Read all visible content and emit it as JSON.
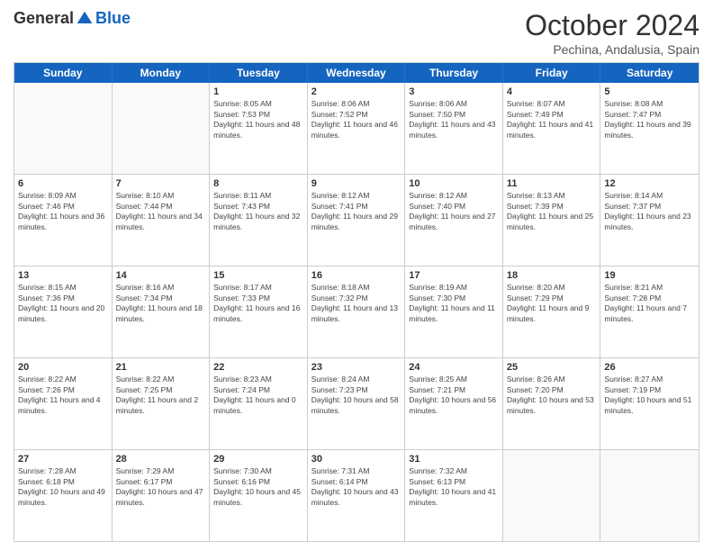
{
  "header": {
    "logo": {
      "general": "General",
      "blue": "Blue"
    },
    "title": "October 2024",
    "location": "Pechina, Andalusia, Spain"
  },
  "calendar": {
    "days": [
      "Sunday",
      "Monday",
      "Tuesday",
      "Wednesday",
      "Thursday",
      "Friday",
      "Saturday"
    ],
    "rows": [
      [
        {
          "day": "",
          "info": ""
        },
        {
          "day": "",
          "info": ""
        },
        {
          "day": "1",
          "info": "Sunrise: 8:05 AM\nSunset: 7:53 PM\nDaylight: 11 hours and 48 minutes."
        },
        {
          "day": "2",
          "info": "Sunrise: 8:06 AM\nSunset: 7:52 PM\nDaylight: 11 hours and 46 minutes."
        },
        {
          "day": "3",
          "info": "Sunrise: 8:06 AM\nSunset: 7:50 PM\nDaylight: 11 hours and 43 minutes."
        },
        {
          "day": "4",
          "info": "Sunrise: 8:07 AM\nSunset: 7:49 PM\nDaylight: 11 hours and 41 minutes."
        },
        {
          "day": "5",
          "info": "Sunrise: 8:08 AM\nSunset: 7:47 PM\nDaylight: 11 hours and 39 minutes."
        }
      ],
      [
        {
          "day": "6",
          "info": "Sunrise: 8:09 AM\nSunset: 7:46 PM\nDaylight: 11 hours and 36 minutes."
        },
        {
          "day": "7",
          "info": "Sunrise: 8:10 AM\nSunset: 7:44 PM\nDaylight: 11 hours and 34 minutes."
        },
        {
          "day": "8",
          "info": "Sunrise: 8:11 AM\nSunset: 7:43 PM\nDaylight: 11 hours and 32 minutes."
        },
        {
          "day": "9",
          "info": "Sunrise: 8:12 AM\nSunset: 7:41 PM\nDaylight: 11 hours and 29 minutes."
        },
        {
          "day": "10",
          "info": "Sunrise: 8:12 AM\nSunset: 7:40 PM\nDaylight: 11 hours and 27 minutes."
        },
        {
          "day": "11",
          "info": "Sunrise: 8:13 AM\nSunset: 7:39 PM\nDaylight: 11 hours and 25 minutes."
        },
        {
          "day": "12",
          "info": "Sunrise: 8:14 AM\nSunset: 7:37 PM\nDaylight: 11 hours and 23 minutes."
        }
      ],
      [
        {
          "day": "13",
          "info": "Sunrise: 8:15 AM\nSunset: 7:36 PM\nDaylight: 11 hours and 20 minutes."
        },
        {
          "day": "14",
          "info": "Sunrise: 8:16 AM\nSunset: 7:34 PM\nDaylight: 11 hours and 18 minutes."
        },
        {
          "day": "15",
          "info": "Sunrise: 8:17 AM\nSunset: 7:33 PM\nDaylight: 11 hours and 16 minutes."
        },
        {
          "day": "16",
          "info": "Sunrise: 8:18 AM\nSunset: 7:32 PM\nDaylight: 11 hours and 13 minutes."
        },
        {
          "day": "17",
          "info": "Sunrise: 8:19 AM\nSunset: 7:30 PM\nDaylight: 11 hours and 11 minutes."
        },
        {
          "day": "18",
          "info": "Sunrise: 8:20 AM\nSunset: 7:29 PM\nDaylight: 11 hours and 9 minutes."
        },
        {
          "day": "19",
          "info": "Sunrise: 8:21 AM\nSunset: 7:28 PM\nDaylight: 11 hours and 7 minutes."
        }
      ],
      [
        {
          "day": "20",
          "info": "Sunrise: 8:22 AM\nSunset: 7:26 PM\nDaylight: 11 hours and 4 minutes."
        },
        {
          "day": "21",
          "info": "Sunrise: 8:22 AM\nSunset: 7:25 PM\nDaylight: 11 hours and 2 minutes."
        },
        {
          "day": "22",
          "info": "Sunrise: 8:23 AM\nSunset: 7:24 PM\nDaylight: 11 hours and 0 minutes."
        },
        {
          "day": "23",
          "info": "Sunrise: 8:24 AM\nSunset: 7:23 PM\nDaylight: 10 hours and 58 minutes."
        },
        {
          "day": "24",
          "info": "Sunrise: 8:25 AM\nSunset: 7:21 PM\nDaylight: 10 hours and 56 minutes."
        },
        {
          "day": "25",
          "info": "Sunrise: 8:26 AM\nSunset: 7:20 PM\nDaylight: 10 hours and 53 minutes."
        },
        {
          "day": "26",
          "info": "Sunrise: 8:27 AM\nSunset: 7:19 PM\nDaylight: 10 hours and 51 minutes."
        }
      ],
      [
        {
          "day": "27",
          "info": "Sunrise: 7:28 AM\nSunset: 6:18 PM\nDaylight: 10 hours and 49 minutes."
        },
        {
          "day": "28",
          "info": "Sunrise: 7:29 AM\nSunset: 6:17 PM\nDaylight: 10 hours and 47 minutes."
        },
        {
          "day": "29",
          "info": "Sunrise: 7:30 AM\nSunset: 6:16 PM\nDaylight: 10 hours and 45 minutes."
        },
        {
          "day": "30",
          "info": "Sunrise: 7:31 AM\nSunset: 6:14 PM\nDaylight: 10 hours and 43 minutes."
        },
        {
          "day": "31",
          "info": "Sunrise: 7:32 AM\nSunset: 6:13 PM\nDaylight: 10 hours and 41 minutes."
        },
        {
          "day": "",
          "info": ""
        },
        {
          "day": "",
          "info": ""
        }
      ]
    ]
  }
}
